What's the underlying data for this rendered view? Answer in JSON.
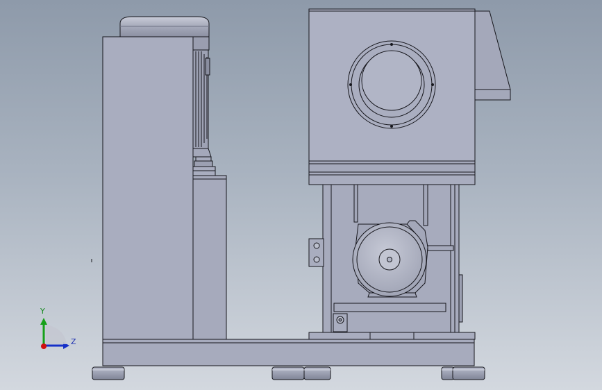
{
  "viewport": {
    "background_top": "#8e9aaa",
    "background_bottom": "#d3d8df"
  },
  "model": {
    "colors": {
      "body": "#a9adbf",
      "body_light": "#b7bbcc",
      "edge": "#16161c",
      "foot": "#9aa0b4"
    }
  },
  "triad": {
    "y_label": "Y",
    "z_label": "Z",
    "colors": {
      "y_axis": "#16a019",
      "z_axis": "#1530c8",
      "x_axis": "#d01010"
    }
  }
}
